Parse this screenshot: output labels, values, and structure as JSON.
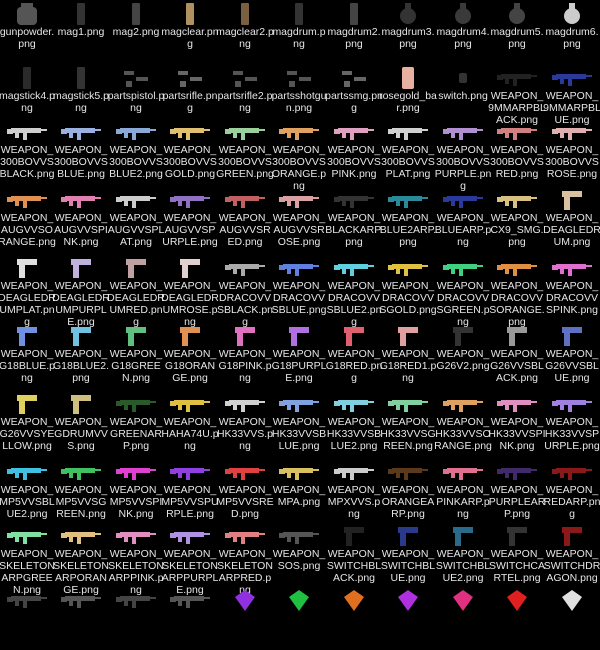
{
  "view": "file icon grid",
  "rows": [
    [
      {
        "label": "gunpowder.png",
        "icon": "bag-icon",
        "color": "#555"
      },
      {
        "label": "mag1.png",
        "icon": "magazine-icon",
        "color": "#333"
      },
      {
        "label": "mag2.png",
        "icon": "magazine-icon",
        "color": "#444"
      },
      {
        "label": "magclear.png",
        "icon": "magazine-icon",
        "color": "#b09060"
      },
      {
        "label": "magclear2.png",
        "icon": "magazine-icon",
        "color": "#7a6040"
      },
      {
        "label": "magdrum.png",
        "icon": "magazine-icon",
        "color": "#333"
      },
      {
        "label": "magdrum2.png",
        "icon": "magazine-icon",
        "color": "#444"
      },
      {
        "label": "magdrum3.png",
        "icon": "drum-icon",
        "color": "#333"
      },
      {
        "label": "magdrum4.png",
        "icon": "drum-icon",
        "color": "#3a3a3a"
      },
      {
        "label": "magdrum5.png",
        "icon": "drum-icon",
        "color": "#444"
      },
      {
        "label": "magdrum6.png",
        "icon": "drum-icon",
        "color": "#ccc"
      }
    ],
    [
      {
        "label": "magstick4.png",
        "icon": "magazine-icon",
        "color": "#2a2a2a"
      },
      {
        "label": "magstick5.png",
        "icon": "magazine-icon",
        "color": "#333"
      },
      {
        "label": "partspistol.png",
        "icon": "parts-icon",
        "color": "#555"
      },
      {
        "label": "partsrifle.png",
        "icon": "parts-icon",
        "color": "#666"
      },
      {
        "label": "partsrifle2.png",
        "icon": "parts-icon",
        "color": "#555"
      },
      {
        "label": "partsshotgun.png",
        "icon": "parts-icon",
        "color": "#555"
      },
      {
        "label": "partssmg.png",
        "icon": "parts-icon",
        "color": "#666"
      },
      {
        "label": "rosegold_bar.png",
        "icon": "bar-icon",
        "color": "#e8b0a0"
      },
      {
        "label": "switch.png",
        "icon": "switch-icon",
        "color": "#333"
      },
      {
        "label": "WEAPON_9MMARPBLACK.png",
        "icon": "gun-icon",
        "color": "#222"
      },
      {
        "label": "WEAPON_9MMARPBLUE.png",
        "icon": "gun-icon",
        "color": "#2a3a9a"
      }
    ],
    [
      {
        "label": "WEAPON_300BOVVSBLACK.png",
        "icon": "gun-icon",
        "color": "#cfcfcf"
      },
      {
        "label": "WEAPON_300BOVVSBLUE.png",
        "icon": "gun-icon",
        "color": "#9ab0e0"
      },
      {
        "label": "WEAPON_300BOVVSBLUE2.png",
        "icon": "gun-icon",
        "color": "#8aa8d8"
      },
      {
        "label": "WEAPON_300BOVVSGOLD.png",
        "icon": "gun-icon",
        "color": "#e0c070"
      },
      {
        "label": "WEAPON_300BOVVSGREEN.png",
        "icon": "gun-icon",
        "color": "#9ad09a"
      },
      {
        "label": "WEAPON_300BOVVSORANGE.png",
        "icon": "gun-icon",
        "color": "#e0a060"
      },
      {
        "label": "WEAPON_300BOVVSPINK.png",
        "icon": "gun-icon",
        "color": "#e0a0c0"
      },
      {
        "label": "WEAPON_300BOVVSPLAT.png",
        "icon": "gun-icon",
        "color": "#d0d0d0"
      },
      {
        "label": "WEAPON_300BOVVSPURPLE.png",
        "icon": "gun-icon",
        "color": "#b090d0"
      },
      {
        "label": "WEAPON_300BOVVSRED.png",
        "icon": "gun-icon",
        "color": "#d08080"
      },
      {
        "label": "WEAPON_300BOVVSROSE.png",
        "icon": "gun-icon",
        "color": "#e0b0b0"
      }
    ],
    [
      {
        "label": "WEAPON_AUGVVSORANGE.png",
        "icon": "gun-icon",
        "color": "#e09050"
      },
      {
        "label": "WEAPON_AUGVVSPINK.png",
        "icon": "gun-icon",
        "color": "#e080b0"
      },
      {
        "label": "WEAPON_AUGVVSPLAT.png",
        "icon": "gun-icon",
        "color": "#cccccc"
      },
      {
        "label": "WEAPON_AUGVVSPURPLE.png",
        "icon": "gun-icon",
        "color": "#9070c0"
      },
      {
        "label": "WEAPON_AUGVVSRED.png",
        "icon": "gun-icon",
        "color": "#c06060"
      },
      {
        "label": "WEAPON_AUGVVSROSE.png",
        "icon": "gun-icon",
        "color": "#d8a0a0"
      },
      {
        "label": "WEAPON_BLACKARP.png",
        "icon": "gun-icon",
        "color": "#333"
      },
      {
        "label": "WEAPON_BLUE2ARP.png",
        "icon": "gun-icon",
        "color": "#2a8a9a"
      },
      {
        "label": "WEAPON_BLUEARP.png",
        "icon": "gun-icon",
        "color": "#2a3a9a"
      },
      {
        "label": "WEAPON_CX9_SMG.png",
        "icon": "gun-icon",
        "color": "#d8c080"
      },
      {
        "label": "WEAPON_DEAGLEDRUM.png",
        "icon": "pistol-icon",
        "color": "#d8c0a0"
      }
    ],
    [
      {
        "label": "WEAPON_DEAGLEDRUMPLAT.png",
        "icon": "pistol-icon",
        "color": "#e0e0e0"
      },
      {
        "label": "WEAPON_DEAGLEDRUMPURPLE.png",
        "icon": "pistol-icon",
        "color": "#c0b0e0"
      },
      {
        "label": "WEAPON_DEAGLEDRUMRED.png",
        "icon": "pistol-icon",
        "color": "#c0a0a0"
      },
      {
        "label": "WEAPON_DEAGLEDRUMROSE.png",
        "icon": "pistol-icon",
        "color": "#e0d0d0"
      },
      {
        "label": "WEAPON_DRACOVVSBLACK.png",
        "icon": "gun-icon",
        "color": "#aaaaaa"
      },
      {
        "label": "WEAPON_DRACOVVSBLUE.png",
        "icon": "gun-icon",
        "color": "#6080e0"
      },
      {
        "label": "WEAPON_DRACOVVSBLUE2.png",
        "icon": "gun-icon",
        "color": "#60d0e0"
      },
      {
        "label": "WEAPON_DRACOVVSGOLD.png",
        "icon": "gun-icon",
        "color": "#e0c040"
      },
      {
        "label": "WEAPON_DRACOVVSGREEN.png",
        "icon": "gun-icon",
        "color": "#40d080"
      },
      {
        "label": "WEAPON_DRACOVVSORANGE.png",
        "icon": "gun-icon",
        "color": "#e09040"
      },
      {
        "label": "WEAPON_DRACOVVSPINK.png",
        "icon": "gun-icon",
        "color": "#e070d0"
      }
    ],
    [
      {
        "label": "WEAPON_G18BLUE.png",
        "icon": "pistol-icon",
        "color": "#7090e0"
      },
      {
        "label": "WEAPON_G18BLUE2.png",
        "icon": "pistol-icon",
        "color": "#70c0e0"
      },
      {
        "label": "WEAPON_G18GREEN.png",
        "icon": "pistol-icon",
        "color": "#60c080"
      },
      {
        "label": "WEAPON_G18ORANGE.png",
        "icon": "pistol-icon",
        "color": "#e09050"
      },
      {
        "label": "WEAPON_G18PINK.png",
        "icon": "pistol-icon",
        "color": "#e070c0"
      },
      {
        "label": "WEAPON_G18PURPLE.png",
        "icon": "pistol-icon",
        "color": "#b070e0"
      },
      {
        "label": "WEAPON_G18RED.png",
        "icon": "pistol-icon",
        "color": "#e06070"
      },
      {
        "label": "WEAPON_G18RED1.png",
        "icon": "pistol-icon",
        "color": "#e0a0a0"
      },
      {
        "label": "WEAPON_G26V2.png",
        "icon": "pistol-icon",
        "color": "#333"
      },
      {
        "label": "WEAPON_G26VVSBLACK.png",
        "icon": "pistol-icon",
        "color": "#999"
      },
      {
        "label": "WEAPON_G26VVSBLUE.png",
        "icon": "pistol-icon",
        "color": "#6070c0"
      }
    ],
    [
      {
        "label": "WEAPON_G26VVSYELLOW.png",
        "icon": "pistol-icon",
        "color": "#e0d060"
      },
      {
        "label": "WEAPON_GDRUMVVS.png",
        "icon": "pistol-icon",
        "color": "#d0c080"
      },
      {
        "label": "WEAPON_GREENARP.png",
        "icon": "gun-icon",
        "color": "#2a5a2a"
      },
      {
        "label": "WEAPON_HAHA74U.png",
        "icon": "gun-icon",
        "color": "#e0c040"
      },
      {
        "label": "WEAPON_HK33VVS.png",
        "icon": "gun-icon",
        "color": "#d0d0d0"
      },
      {
        "label": "WEAPON_HK33VVSBLUE.png",
        "icon": "gun-icon",
        "color": "#80a0e0"
      },
      {
        "label": "WEAPON_HK33VVSBLUE2.png",
        "icon": "gun-icon",
        "color": "#80d0e0"
      },
      {
        "label": "WEAPON_HK33VVSGREEN.png",
        "icon": "gun-icon",
        "color": "#80d0a0"
      },
      {
        "label": "WEAPON_HK33VVSORANGE.png",
        "icon": "gun-icon",
        "color": "#e0a060"
      },
      {
        "label": "WEAPON_HK33VVSPINK.png",
        "icon": "gun-icon",
        "color": "#e090c0"
      },
      {
        "label": "WEAPON_HK33VVSPURPLE.png",
        "icon": "gun-icon",
        "color": "#a080e0"
      }
    ],
    [
      {
        "label": "WEAPON_MP5VVSBLUE2.png",
        "icon": "gun-icon",
        "color": "#40c0e0"
      },
      {
        "label": "WEAPON_MP5VVSGREEN.png",
        "icon": "gun-icon",
        "color": "#40c060"
      },
      {
        "label": "WEAPON_MP5VVSPINK.png",
        "icon": "gun-icon",
        "color": "#e040d0"
      },
      {
        "label": "WEAPON_MP5VVSPURPLE.png",
        "icon": "gun-icon",
        "color": "#9040e0"
      },
      {
        "label": "WEAPON_MP5VVSRED.png",
        "icon": "gun-icon",
        "color": "#e04040"
      },
      {
        "label": "WEAPON_MPA.png",
        "icon": "gun-icon",
        "color": "#d8c060"
      },
      {
        "label": "WEAPON_MPXVVS.png",
        "icon": "gun-icon",
        "color": "#cccccc"
      },
      {
        "label": "WEAPON_ORANGEARP.png",
        "icon": "gun-icon",
        "color": "#5a3a1a"
      },
      {
        "label": "WEAPON_PINKARP.png",
        "icon": "gun-icon",
        "color": "#e07090"
      },
      {
        "label": "WEAPON_PURPLEARP.png",
        "icon": "gun-icon",
        "color": "#402a6a"
      },
      {
        "label": "WEAPON_REDARP.png",
        "icon": "gun-icon",
        "color": "#8a1a1a"
      }
    ],
    [
      {
        "label": "WEAPON_SKELETONARPGREEN.png",
        "icon": "gun-icon",
        "color": "#80e0a0"
      },
      {
        "label": "WEAPON_SKELETONARPORANGE.png",
        "icon": "gun-icon",
        "color": "#e0c080"
      },
      {
        "label": "WEAPON_SKELETONARPPINK.png",
        "icon": "gun-icon",
        "color": "#e090c0"
      },
      {
        "label": "WEAPON_SKELETONARPPURPLE.png",
        "icon": "gun-icon",
        "color": "#b090e0"
      },
      {
        "label": "WEAPON_SKELETONARPRED.png",
        "icon": "gun-icon",
        "color": "#e08080"
      },
      {
        "label": "WEAPON_SOS.png",
        "icon": "gun-icon",
        "color": "#555"
      },
      {
        "label": "WEAPON_SWITCHBLACK.png",
        "icon": "pistol-icon",
        "color": "#222"
      },
      {
        "label": "WEAPON_SWITCHBLUE.png",
        "icon": "pistol-icon",
        "color": "#2a3a8a"
      },
      {
        "label": "WEAPON_SWITCHBLUE2.png",
        "icon": "pistol-icon",
        "color": "#2a6a8a"
      },
      {
        "label": "WEAPON_SWITCHCARTEL.png",
        "icon": "pistol-icon",
        "color": "#333"
      },
      {
        "label": "WEAPON_SWITCHDRAGON.png",
        "icon": "pistol-icon",
        "color": "#8a1a1a"
      }
    ],
    [
      {
        "label": "",
        "icon": "gun-icon",
        "color": "#444"
      },
      {
        "label": "",
        "icon": "gun-icon",
        "color": "#555"
      },
      {
        "label": "",
        "icon": "gun-icon",
        "color": "#444"
      },
      {
        "label": "",
        "icon": "gun-icon",
        "color": "#555"
      },
      {
        "label": "",
        "icon": "gem-icon",
        "color": "#9030e0"
      },
      {
        "label": "",
        "icon": "gem-icon",
        "color": "#20c040"
      },
      {
        "label": "",
        "icon": "gem-icon",
        "color": "#e07020"
      },
      {
        "label": "",
        "icon": "gem-icon",
        "color": "#b030e0"
      },
      {
        "label": "",
        "icon": "gem-icon",
        "color": "#e03080"
      },
      {
        "label": "",
        "icon": "gem-icon",
        "color": "#e02020"
      },
      {
        "label": "",
        "icon": "gem-icon",
        "color": "#e0e0e0"
      }
    ]
  ]
}
